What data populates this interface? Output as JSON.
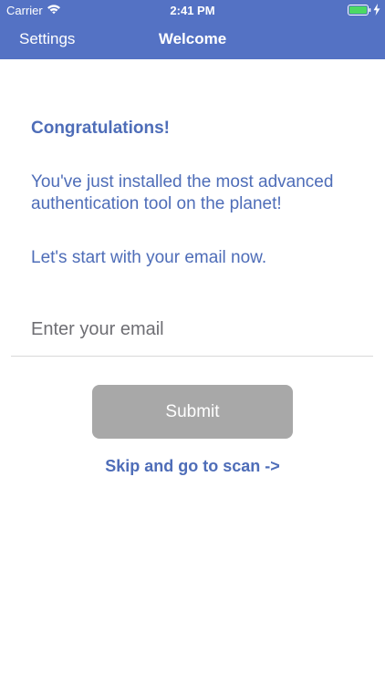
{
  "status_bar": {
    "carrier": "Carrier",
    "time": "2:41 PM",
    "wifi_icon": "wifi-icon",
    "battery_icon": "battery-icon",
    "charging_icon": "bolt-icon"
  },
  "nav": {
    "back_label": "Settings",
    "title": "Welcome",
    "background_color": "#5472c4"
  },
  "content": {
    "heading": "Congratulations!",
    "intro": "You've just installed the most advanced authentication tool on the planet!",
    "prompt": "Let's start with your email now.",
    "text_color": "#4e6db8"
  },
  "email": {
    "placeholder": "Enter your email",
    "value": ""
  },
  "submit": {
    "label": "Submit",
    "background_color": "#a8a8a8"
  },
  "skip": {
    "label": "Skip and go to scan ->"
  }
}
